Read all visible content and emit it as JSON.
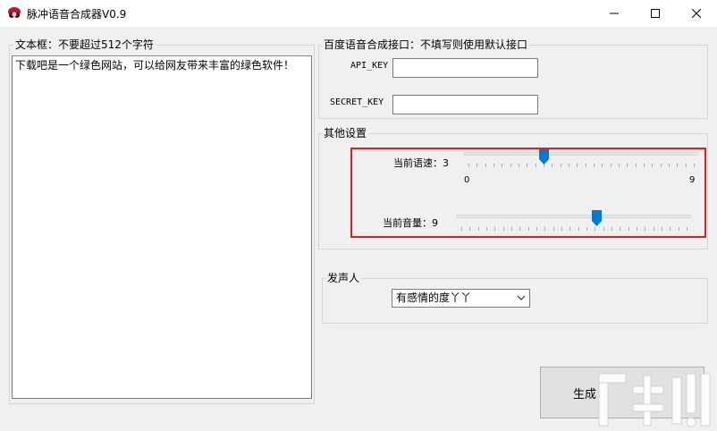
{
  "window": {
    "title": "脉冲语音合成器V0.9",
    "controls": {
      "minimize": "—",
      "maximize": "☐",
      "close": "✕"
    }
  },
  "text_group": {
    "legend": "文本框：不要超过512个字符",
    "content": "下载吧是一个绿色网站，可以给网友带来丰富的绿色软件！"
  },
  "api_group": {
    "legend": "百度语音合成接口：不填写则使用默认接口",
    "api_key_label": "API_KEY",
    "api_key_value": "",
    "secret_key_label": "SECRET_KEY",
    "secret_key_value": ""
  },
  "other_settings": {
    "legend": "其他设置",
    "speed_label": "当前语速：3",
    "speed_value": 3,
    "speed_min_label": "0",
    "speed_max_label": "9",
    "speed_max": 9,
    "volume_label": "当前音量：9",
    "volume_value": 9,
    "volume_max": 15
  },
  "speaker_group": {
    "legend": "发声人",
    "selected": "有感情的度丫丫"
  },
  "actions": {
    "generate_label": "生成"
  },
  "colors": {
    "thumb": "#0078d7",
    "highlight": "#e02020"
  },
  "icons": [
    "app-icon",
    "chevron-down-icon"
  ]
}
